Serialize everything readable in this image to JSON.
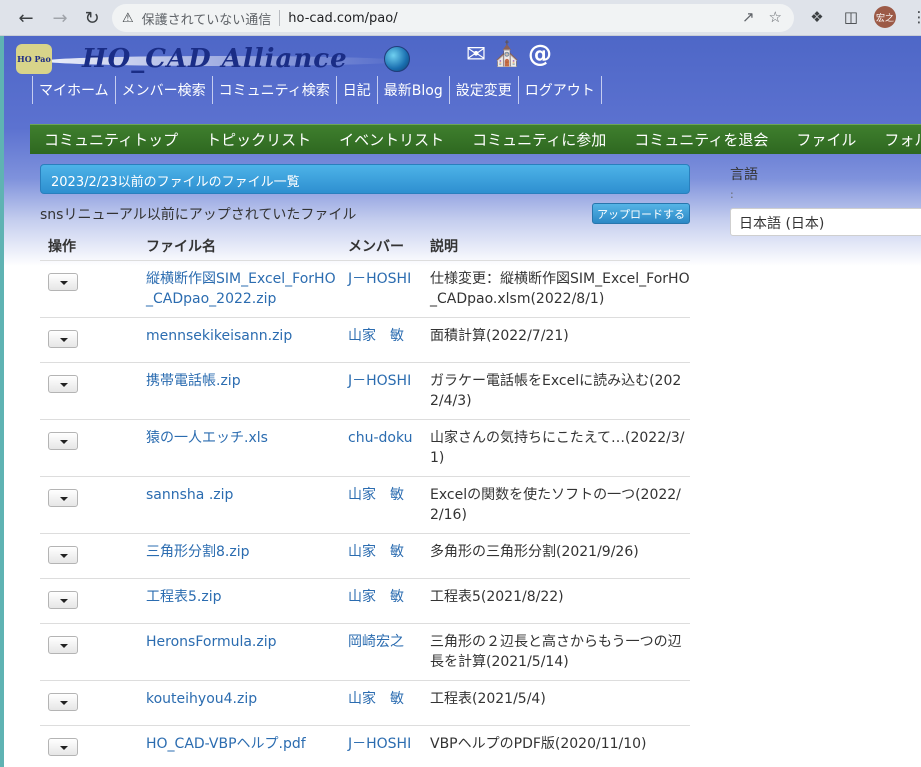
{
  "browser": {
    "security_label": "保護されていない通信",
    "url": "ho-cad.com/pao/",
    "avatar_text": "宏之"
  },
  "site": {
    "logo_badge": "HO Pao",
    "logo_text": "HO_CAD Alliance",
    "menu": [
      "マイホーム",
      "メンバー検索",
      "コミュニティ検索",
      "日記",
      "最新Blog",
      "設定変更",
      "ログアウト"
    ],
    "subnav": [
      "コミュニティトップ",
      "トピックリスト",
      "イベントリスト",
      "コミュニティに参加",
      "コミュニティを退会",
      "ファイル",
      "フォルダ"
    ]
  },
  "main": {
    "panel_title": "2023/2/23以前のファイルのファイル一覧",
    "subtitle": "snsリニューアル以前にアップされていたファイル",
    "upload_label": "アップロードする",
    "columns": [
      "操作",
      "ファイル名",
      "メンバー",
      "説明"
    ],
    "rows": [
      {
        "file": "縦横断作図SIM_Excel_ForHO_CADpao_2022.zip",
        "member": "J－HOSHI",
        "desc": "仕様変更：縦横断作図SIM_Excel_ForHO_CADpao.xlsm(2022/8/1)"
      },
      {
        "file": "mennsekikeisann.zip",
        "member": "山家　敏",
        "desc": "面積計算(2022/7/21)"
      },
      {
        "file": "携帯電話帳.zip",
        "member": "J－HOSHI",
        "desc": "ガラケー電話帳をExcelに読み込む(2022/4/3)"
      },
      {
        "file": "猿の一人エッチ.xls",
        "member": "chu-doku",
        "desc": "山家さんの気持ちにこたえて…(2022/3/1)"
      },
      {
        "file": "sannsha .zip",
        "member": "山家　敏",
        "desc": "Excelの関数を使たソフトの一つ(2022/2/16)"
      },
      {
        "file": "三角形分割8.zip",
        "member": "山家　敏",
        "desc": "多角形の三角形分割(2021/9/26)"
      },
      {
        "file": "工程表5.zip",
        "member": "山家　敏",
        "desc": "工程表5(2021/8/22)"
      },
      {
        "file": "HeronsFormula.zip",
        "member": "岡崎宏之",
        "desc": "三角形の２辺長と高さからもう一つの辺長を計算(2021/5/14)"
      },
      {
        "file": "kouteihyou4.zip",
        "member": "山家　敏",
        "desc": "工程表(2021/5/4)"
      },
      {
        "file": "HO_CAD-VBPヘルプ.pdf",
        "member": "J－HOSHI",
        "desc": "VBPヘルプのPDF版(2020/11/10)"
      }
    ]
  },
  "sidebar": {
    "lang_label": "言語",
    "lang_colon": ":",
    "lang_value": "日本語 (日本)"
  }
}
